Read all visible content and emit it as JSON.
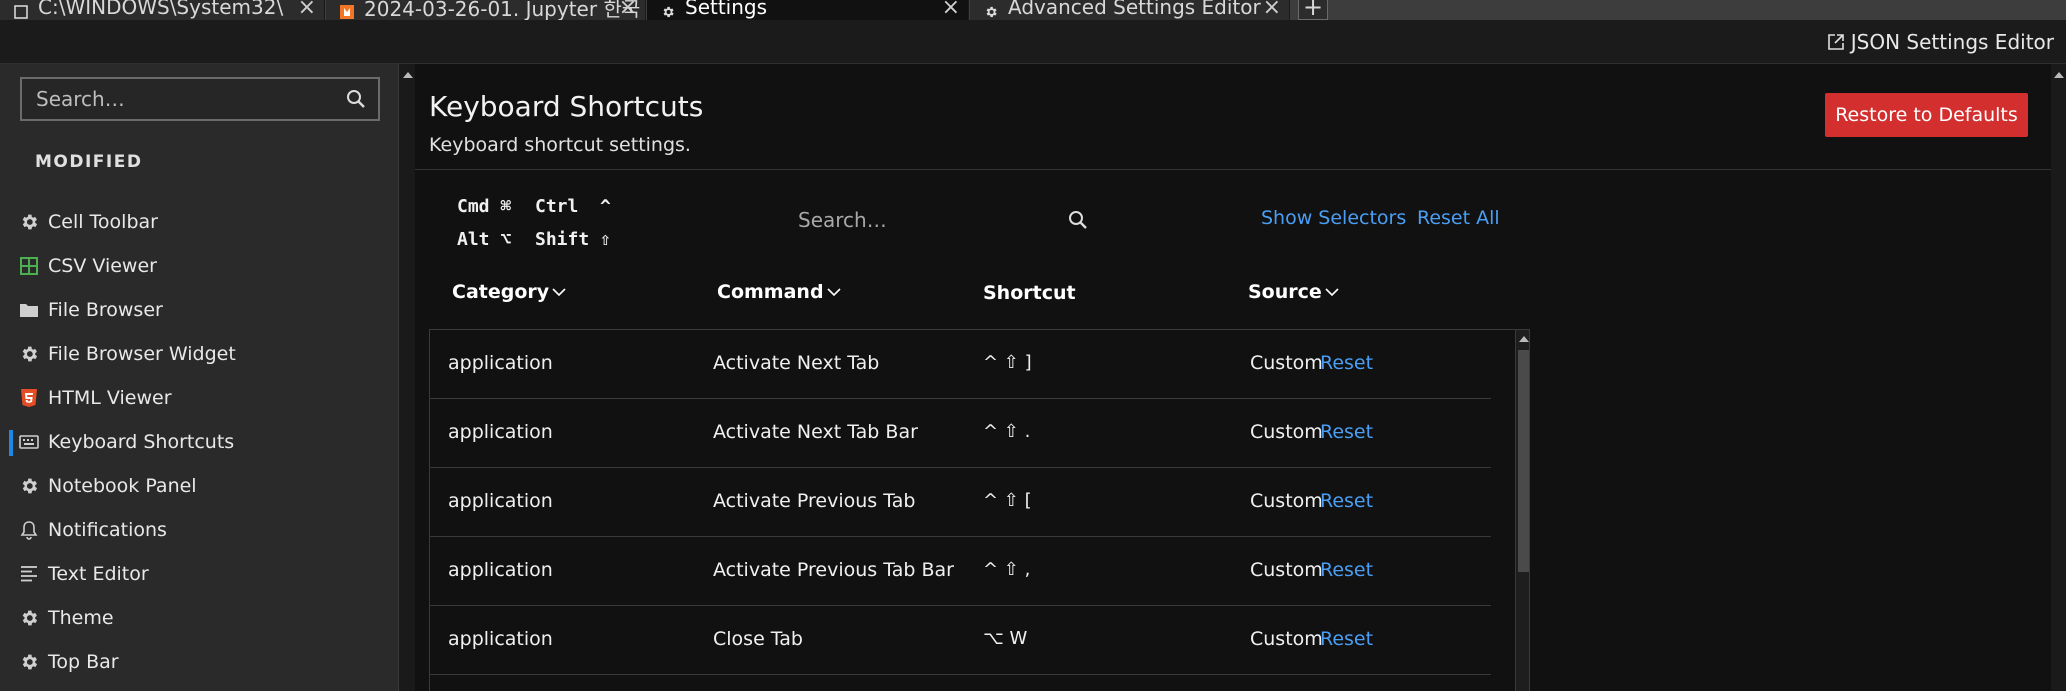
{
  "tabs": [
    {
      "label": "C:\\WINDOWS\\System32\\",
      "icon": "terminal-icon"
    },
    {
      "label": "2024-03-26-01. Jupyter 한국",
      "icon": "notebook-icon"
    },
    {
      "label": "Settings",
      "icon": "gear-icon"
    },
    {
      "label": "Advanced Settings Editor",
      "icon": "gear-icon"
    }
  ],
  "toolbar": {
    "json_editor": "JSON Settings Editor"
  },
  "sidebar": {
    "search_placeholder": "Search…",
    "section": "MODIFIED",
    "items": [
      {
        "label": "Cell Toolbar",
        "icon": "gear-icon"
      },
      {
        "label": "CSV Viewer",
        "icon": "spreadsheet-icon"
      },
      {
        "label": "File Browser",
        "icon": "folder-icon"
      },
      {
        "label": "File Browser Widget",
        "icon": "gear-icon"
      },
      {
        "label": "HTML Viewer",
        "icon": "html5-icon"
      },
      {
        "label": "Keyboard Shortcuts",
        "icon": "keyboard-icon"
      },
      {
        "label": "Notebook Panel",
        "icon": "gear-icon"
      },
      {
        "label": "Notifications",
        "icon": "bell-icon"
      },
      {
        "label": "Text Editor",
        "icon": "text-lines-icon"
      },
      {
        "label": "Theme",
        "icon": "gear-icon"
      },
      {
        "label": "Top Bar",
        "icon": "gear-icon"
      }
    ]
  },
  "main": {
    "title": "Keyboard Shortcuts",
    "subtitle": "Keyboard shortcut settings.",
    "restore_button": "Restore to Defaults",
    "legend": {
      "cmd": "Cmd",
      "cmd_sym": "⌘",
      "ctrl": "Ctrl",
      "ctrl_sym": "^",
      "alt": "Alt",
      "alt_sym": "⌥",
      "shift": "Shift",
      "shift_sym": "⇧"
    },
    "search_placeholder": "Search…",
    "show_selectors": "Show Selectors",
    "reset_all": "Reset All",
    "columns": {
      "category": "Category",
      "command": "Command",
      "shortcut": "Shortcut",
      "source": "Source"
    },
    "rows": [
      {
        "category": "application",
        "command": "Activate Next Tab",
        "shortcut": "^ ⇧ ]",
        "source": "Custom",
        "action": "Reset"
      },
      {
        "category": "application",
        "command": "Activate Next Tab Bar",
        "shortcut": "^ ⇧ .",
        "source": "Custom",
        "action": "Reset"
      },
      {
        "category": "application",
        "command": "Activate Previous Tab",
        "shortcut": "^ ⇧ [",
        "source": "Custom",
        "action": "Reset"
      },
      {
        "category": "application",
        "command": "Activate Previous Tab Bar",
        "shortcut": "^ ⇧ ,",
        "source": "Custom",
        "action": "Reset"
      },
      {
        "category": "application",
        "command": "Close Tab",
        "shortcut": "⌥ W",
        "source": "Custom",
        "action": "Reset"
      }
    ]
  },
  "colors": {
    "accent": "#4a9ff5",
    "danger": "#d32f2f",
    "active_marker": "#1e88e5"
  }
}
